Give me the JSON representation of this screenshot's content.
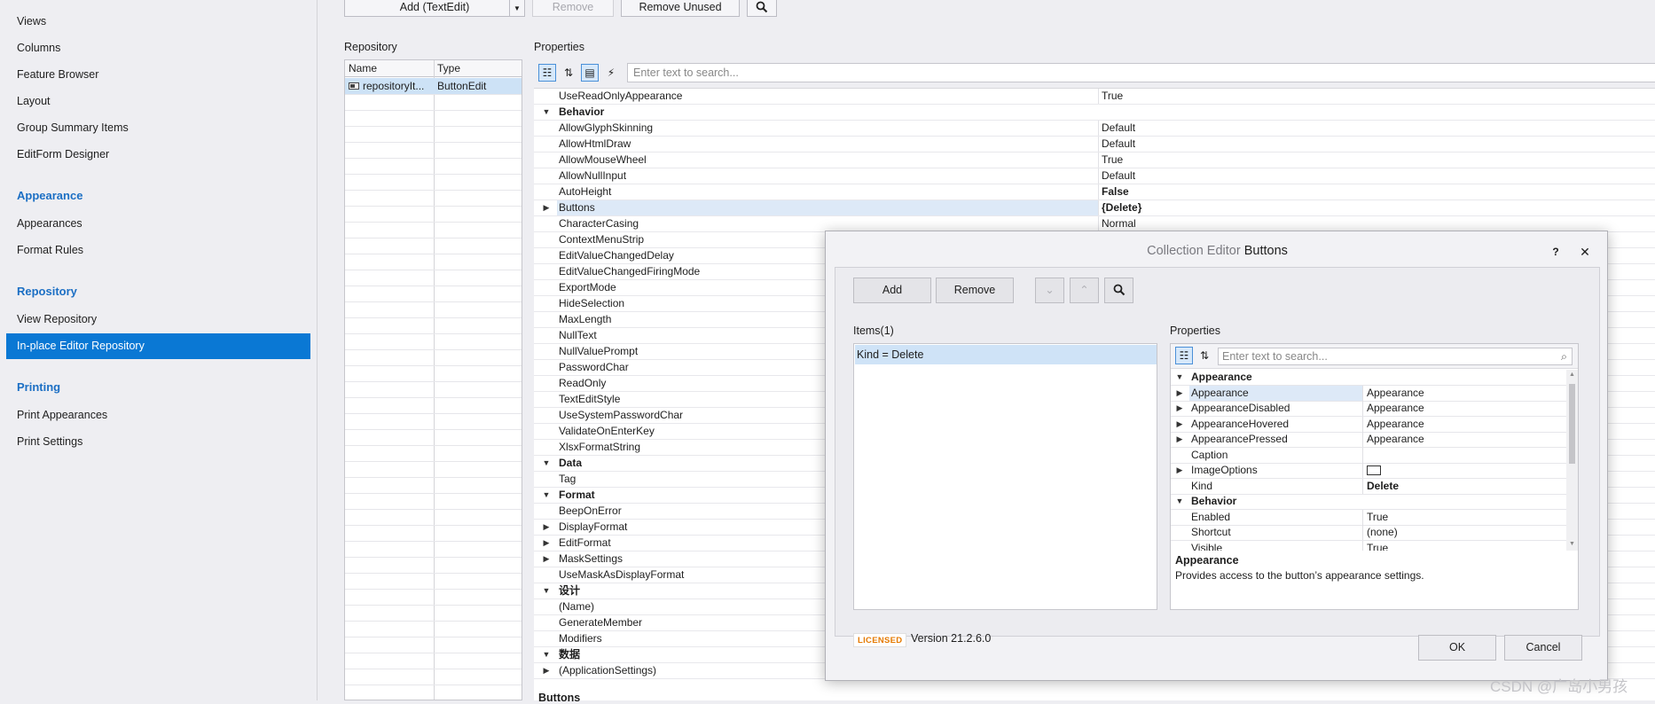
{
  "sidebar": {
    "items_top": [
      "Views",
      "Columns",
      "Feature Browser",
      "Layout",
      "Group Summary Items",
      "EditForm Designer"
    ],
    "group_appearance": "Appearance",
    "items_appearance": [
      "Appearances",
      "Format Rules"
    ],
    "group_repository": "Repository",
    "items_repository": [
      "View Repository",
      "In-place Editor Repository"
    ],
    "group_printing": "Printing",
    "items_printing": [
      "Print Appearances",
      "Print Settings"
    ],
    "selected_item": "In-place Editor Repository"
  },
  "toolbar": {
    "add_label": "Add (TextEdit)",
    "remove_label": "Remove",
    "remove_unused_label": "Remove Unused",
    "search_icon": "search-icon"
  },
  "repository": {
    "label": "Repository",
    "col_name": "Name",
    "col_type": "Type",
    "rows": [
      {
        "name": "repositoryIt...",
        "type": "ButtonEdit"
      }
    ]
  },
  "properties": {
    "label": "Properties",
    "search_placeholder": "Enter text to search...",
    "rows": [
      {
        "kind": "prop",
        "name": "UseReadOnlyAppearance",
        "value": "True"
      },
      {
        "kind": "cat",
        "name": "Behavior"
      },
      {
        "kind": "prop",
        "name": "AllowGlyphSkinning",
        "value": "Default"
      },
      {
        "kind": "prop",
        "name": "AllowHtmlDraw",
        "value": "Default"
      },
      {
        "kind": "prop",
        "name": "AllowMouseWheel",
        "value": "True"
      },
      {
        "kind": "prop",
        "name": "AllowNullInput",
        "value": "Default"
      },
      {
        "kind": "prop",
        "name": "AutoHeight",
        "value": "False",
        "bold": true
      },
      {
        "kind": "prop",
        "name": "Buttons",
        "value": "{Delete}",
        "bold": true,
        "expandable": true,
        "selected": true
      },
      {
        "kind": "prop",
        "name": "CharacterCasing",
        "value": "Normal"
      },
      {
        "kind": "prop",
        "name": "ContextMenuStrip",
        "value": ""
      },
      {
        "kind": "prop",
        "name": "EditValueChangedDelay",
        "value": ""
      },
      {
        "kind": "prop",
        "name": "EditValueChangedFiringMode",
        "value": ""
      },
      {
        "kind": "prop",
        "name": "ExportMode",
        "value": ""
      },
      {
        "kind": "prop",
        "name": "HideSelection",
        "value": ""
      },
      {
        "kind": "prop",
        "name": "MaxLength",
        "value": ""
      },
      {
        "kind": "prop",
        "name": "NullText",
        "value": ""
      },
      {
        "kind": "prop",
        "name": "NullValuePrompt",
        "value": ""
      },
      {
        "kind": "prop",
        "name": "PasswordChar",
        "value": ""
      },
      {
        "kind": "prop",
        "name": "ReadOnly",
        "value": ""
      },
      {
        "kind": "prop",
        "name": "TextEditStyle",
        "value": ""
      },
      {
        "kind": "prop",
        "name": "UseSystemPasswordChar",
        "value": ""
      },
      {
        "kind": "prop",
        "name": "ValidateOnEnterKey",
        "value": ""
      },
      {
        "kind": "prop",
        "name": "XlsxFormatString",
        "value": ""
      },
      {
        "kind": "cat",
        "name": "Data"
      },
      {
        "kind": "prop",
        "name": "Tag",
        "value": ""
      },
      {
        "kind": "cat",
        "name": "Format"
      },
      {
        "kind": "prop",
        "name": "BeepOnError",
        "value": ""
      },
      {
        "kind": "prop",
        "name": "DisplayFormat",
        "value": "",
        "expandable": true
      },
      {
        "kind": "prop",
        "name": "EditFormat",
        "value": "",
        "expandable": true
      },
      {
        "kind": "prop",
        "name": "MaskSettings",
        "value": "",
        "expandable": true
      },
      {
        "kind": "prop",
        "name": "UseMaskAsDisplayFormat",
        "value": ""
      },
      {
        "kind": "cat",
        "name": "设计"
      },
      {
        "kind": "prop",
        "name": "(Name)",
        "value": ""
      },
      {
        "kind": "prop",
        "name": "GenerateMember",
        "value": ""
      },
      {
        "kind": "prop",
        "name": "Modifiers",
        "value": ""
      },
      {
        "kind": "cat",
        "name": "数据"
      },
      {
        "kind": "prop",
        "name": "(ApplicationSettings)",
        "value": "",
        "expandable": true
      }
    ],
    "desc_title": "Buttons"
  },
  "dialog": {
    "title_prefix": "Collection Editor",
    "title_name": "Buttons",
    "help_label": "?",
    "close_label": "✕",
    "add_label": "Add",
    "remove_label": "Remove",
    "items_label": "Items(1)",
    "items": [
      "Kind = Delete"
    ],
    "props_label": "Properties",
    "props_search_placeholder": "Enter text to search...",
    "props_rows": [
      {
        "kind": "cat",
        "name": "Appearance"
      },
      {
        "kind": "prop",
        "name": "Appearance",
        "value": "Appearance",
        "expandable": true,
        "selected": true
      },
      {
        "kind": "prop",
        "name": "AppearanceDisabled",
        "value": "Appearance",
        "expandable": true
      },
      {
        "kind": "prop",
        "name": "AppearanceHovered",
        "value": "Appearance",
        "expandable": true
      },
      {
        "kind": "prop",
        "name": "AppearancePressed",
        "value": "Appearance",
        "expandable": true
      },
      {
        "kind": "prop",
        "name": "Caption",
        "value": ""
      },
      {
        "kind": "prop",
        "name": "ImageOptions",
        "value": "",
        "expandable": true,
        "swatch": true
      },
      {
        "kind": "prop",
        "name": "Kind",
        "value": "Delete",
        "bold": true
      },
      {
        "kind": "cat",
        "name": "Behavior"
      },
      {
        "kind": "prop",
        "name": "Enabled",
        "value": "True"
      },
      {
        "kind": "prop",
        "name": "Shortcut",
        "value": "(none)"
      },
      {
        "kind": "prop",
        "name": "Visible",
        "value": "True"
      }
    ],
    "desc_title": "Appearance",
    "desc_text": "Provides access to the button’s appearance settings.",
    "licensed_label": "LICENSED",
    "version_label": "Version 21.2.6.0",
    "ok_label": "OK",
    "cancel_label": "Cancel"
  },
  "watermark": "CSDN @广岛小男孩",
  "colors": {
    "accent": "#0a78d4",
    "group_text": "#1c6fc4",
    "selection_bg": "#dde9f7",
    "licensed": "#e57a00"
  }
}
